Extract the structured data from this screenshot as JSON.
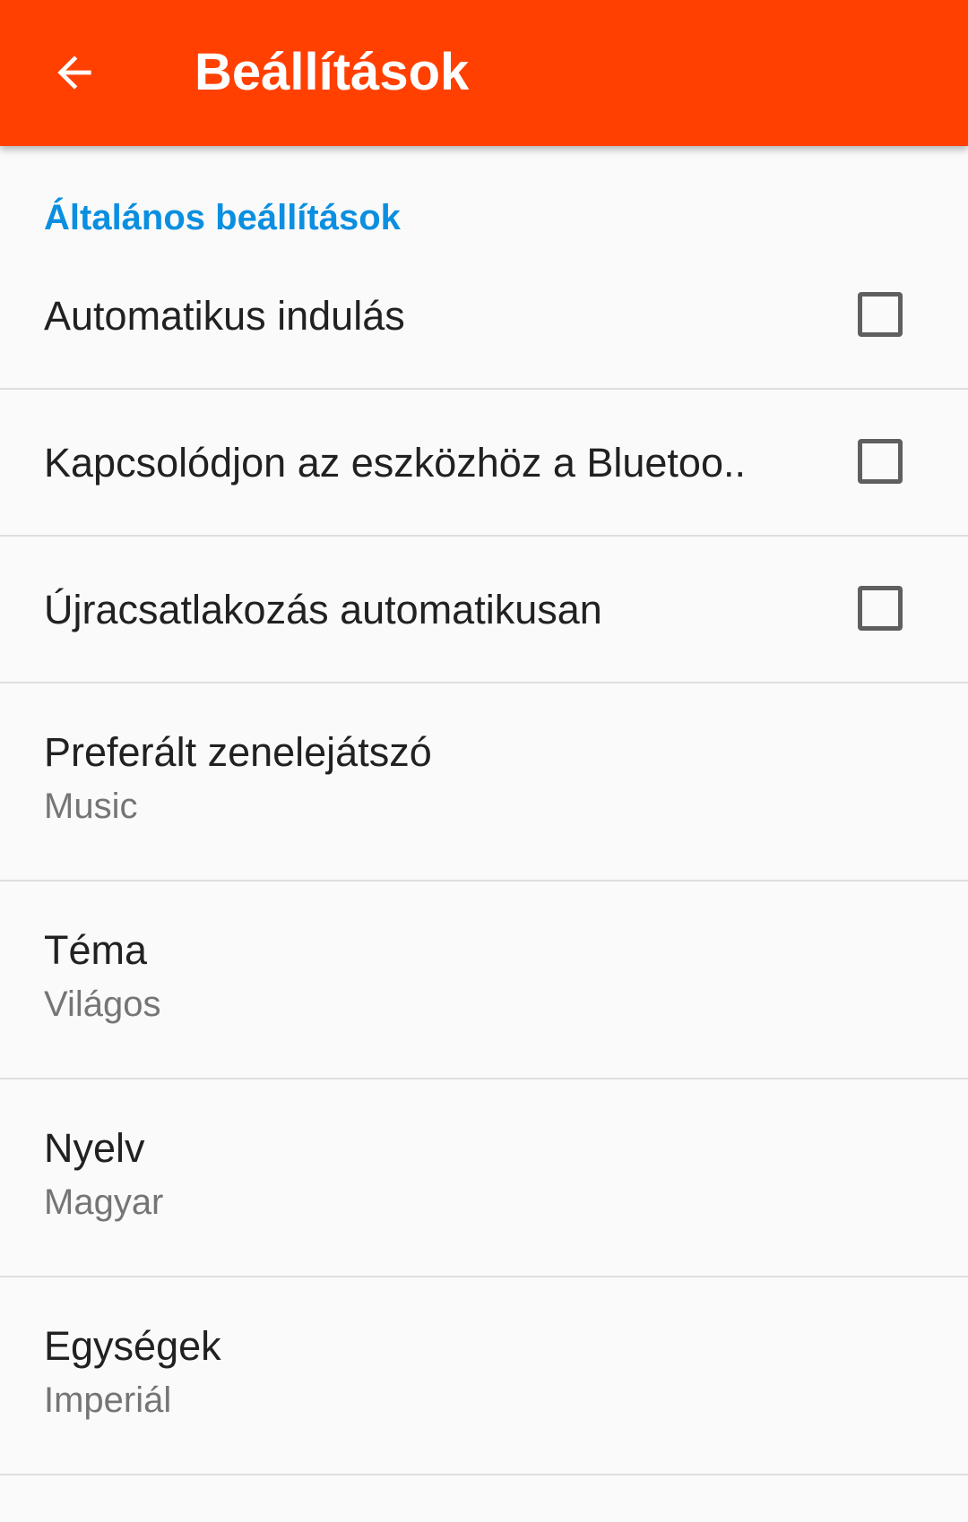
{
  "app_bar": {
    "back_icon": "arrow-left-icon",
    "title": "Beállítások",
    "background_color": "#ff4000"
  },
  "section": {
    "header": "Általános beállítások",
    "header_color": "#0b8fe0"
  },
  "checkbox_prefs": [
    {
      "label": "Automatikus indulás",
      "checked": false
    },
    {
      "label": "Kapcsolódjon az eszközhöz a Bluetoo..",
      "checked": false
    },
    {
      "label": "Újracsatlakozás automatikusan",
      "checked": false
    }
  ],
  "list_prefs": [
    {
      "title": "Preferált zenelejátszó",
      "value": "Music"
    },
    {
      "title": "Téma",
      "value": "Világos"
    },
    {
      "title": "Nyelv",
      "value": "Magyar"
    },
    {
      "title": "Egységek",
      "value": "Imperiál"
    }
  ]
}
